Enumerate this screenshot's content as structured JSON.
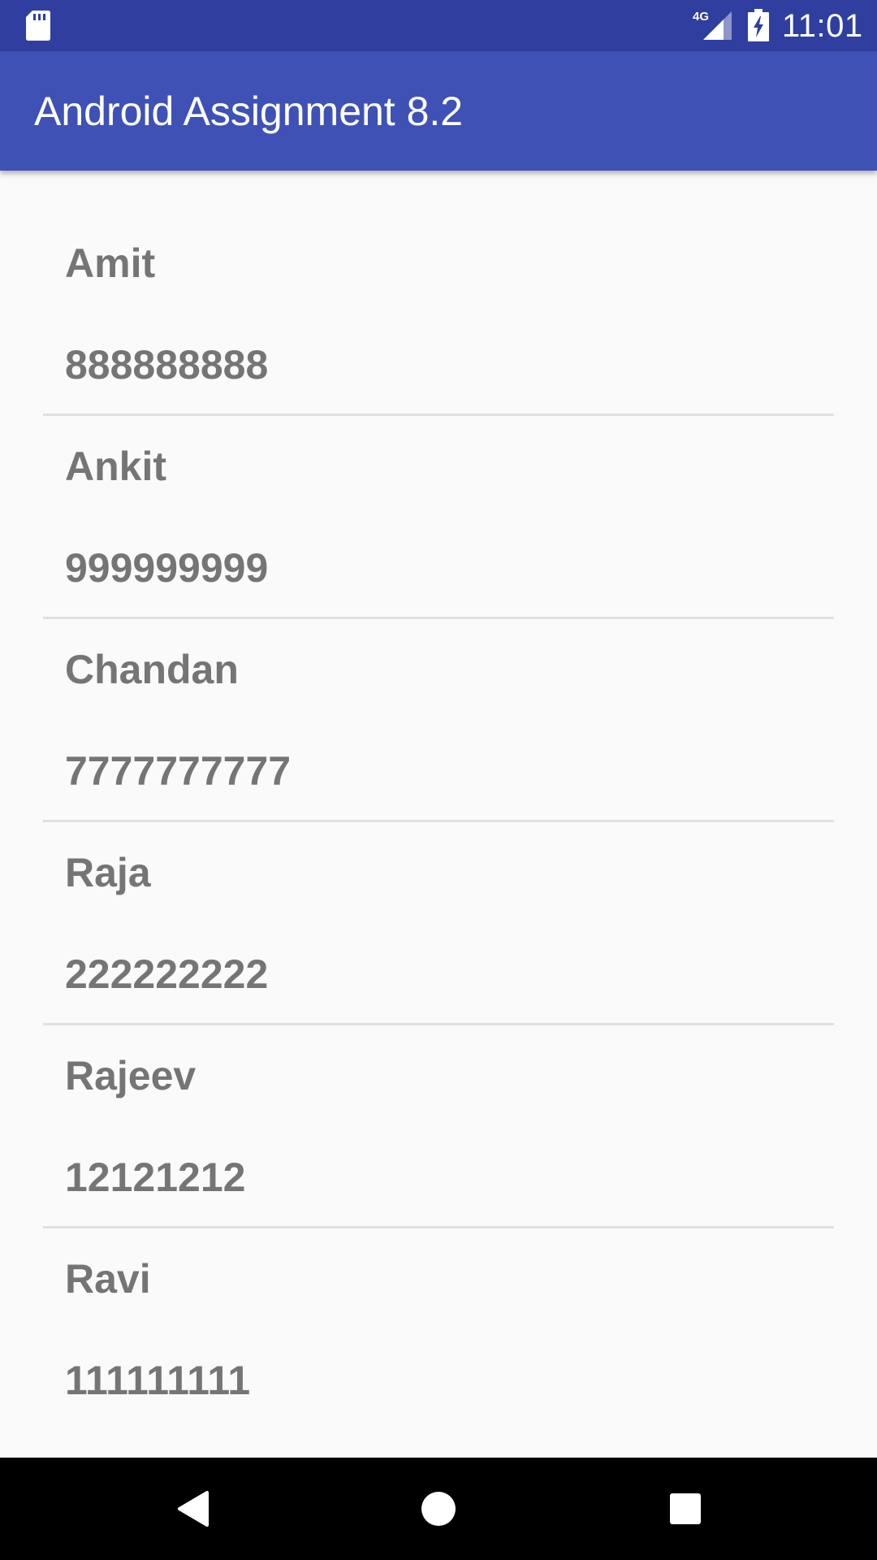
{
  "status_bar": {
    "network_label": "4G",
    "time": "11:01",
    "icons": [
      "sd-card-icon",
      "cell-signal-icon",
      "battery-charging-icon"
    ]
  },
  "app_bar": {
    "title": "Android Assignment 8.2"
  },
  "contacts": [
    {
      "name": "Amit",
      "phone": "888888888"
    },
    {
      "name": "Ankit",
      "phone": "999999999"
    },
    {
      "name": "Chandan",
      "phone": "7777777777"
    },
    {
      "name": "Raja",
      "phone": "222222222"
    },
    {
      "name": "Rajeev",
      "phone": "12121212"
    },
    {
      "name": "Ravi",
      "phone": "111111111"
    }
  ],
  "nav_bar": {
    "icons": [
      "back-icon",
      "home-icon",
      "recents-icon"
    ]
  },
  "colors": {
    "status_bar": "#303F9F",
    "app_bar": "#3F51B5",
    "background": "#FAFAFA",
    "list_text": "#757575",
    "divider": "#E0E0E0",
    "nav_bar": "#000000"
  }
}
